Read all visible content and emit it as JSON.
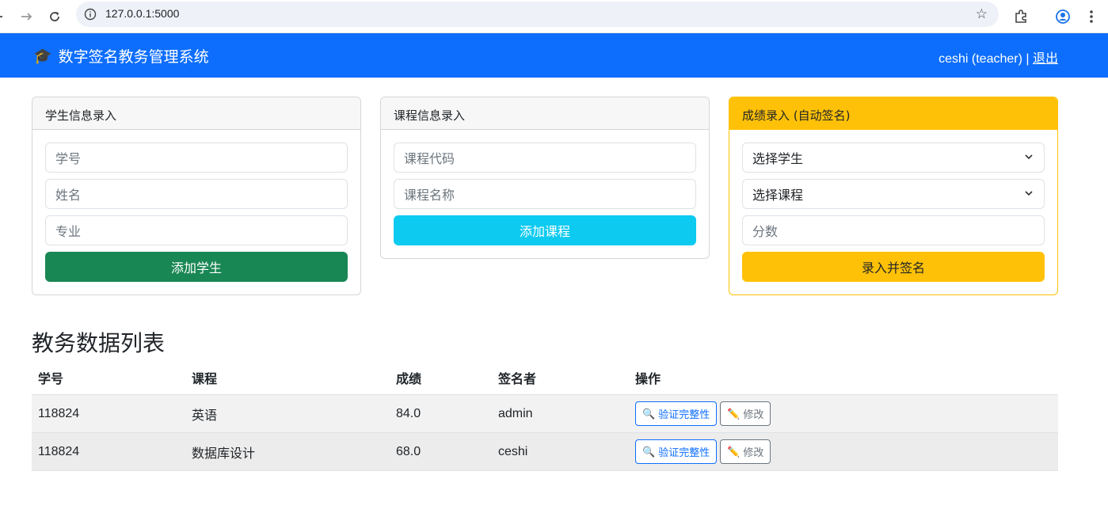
{
  "browser": {
    "url": "127.0.0.1:5000"
  },
  "navbar": {
    "brand_icon": "🎓",
    "brand": "数字签名教务管理系统",
    "user": "ceshi (teacher) | ",
    "logout": "退出"
  },
  "student_card": {
    "title": "学生信息录入",
    "id_placeholder": "学号",
    "name_placeholder": "姓名",
    "major_placeholder": "专业",
    "submit": "添加学生"
  },
  "course_card": {
    "title": "课程信息录入",
    "code_placeholder": "课程代码",
    "name_placeholder": "课程名称",
    "submit": "添加课程"
  },
  "grade_card": {
    "title": "成绩录入 (自动签名)",
    "student_select": "选择学生",
    "course_select": "选择课程",
    "score_placeholder": "分数",
    "submit": "录入并签名"
  },
  "table": {
    "title": "教务数据列表",
    "headers": [
      "学号",
      "课程",
      "成绩",
      "签名者",
      "操作"
    ],
    "rows": [
      {
        "id": "118824",
        "course": "英语",
        "score": "84.0",
        "signer": "admin"
      },
      {
        "id": "118824",
        "course": "数据库设计",
        "score": "68.0",
        "signer": "ceshi"
      }
    ],
    "verify_label": "验证完整性",
    "edit_label": "修改",
    "verify_icon": "🔍",
    "edit_icon": "✏️"
  },
  "colors": {
    "primary": "#0d6efd",
    "success": "#198754",
    "info": "#0dcaf0",
    "warning": "#ffc107"
  }
}
